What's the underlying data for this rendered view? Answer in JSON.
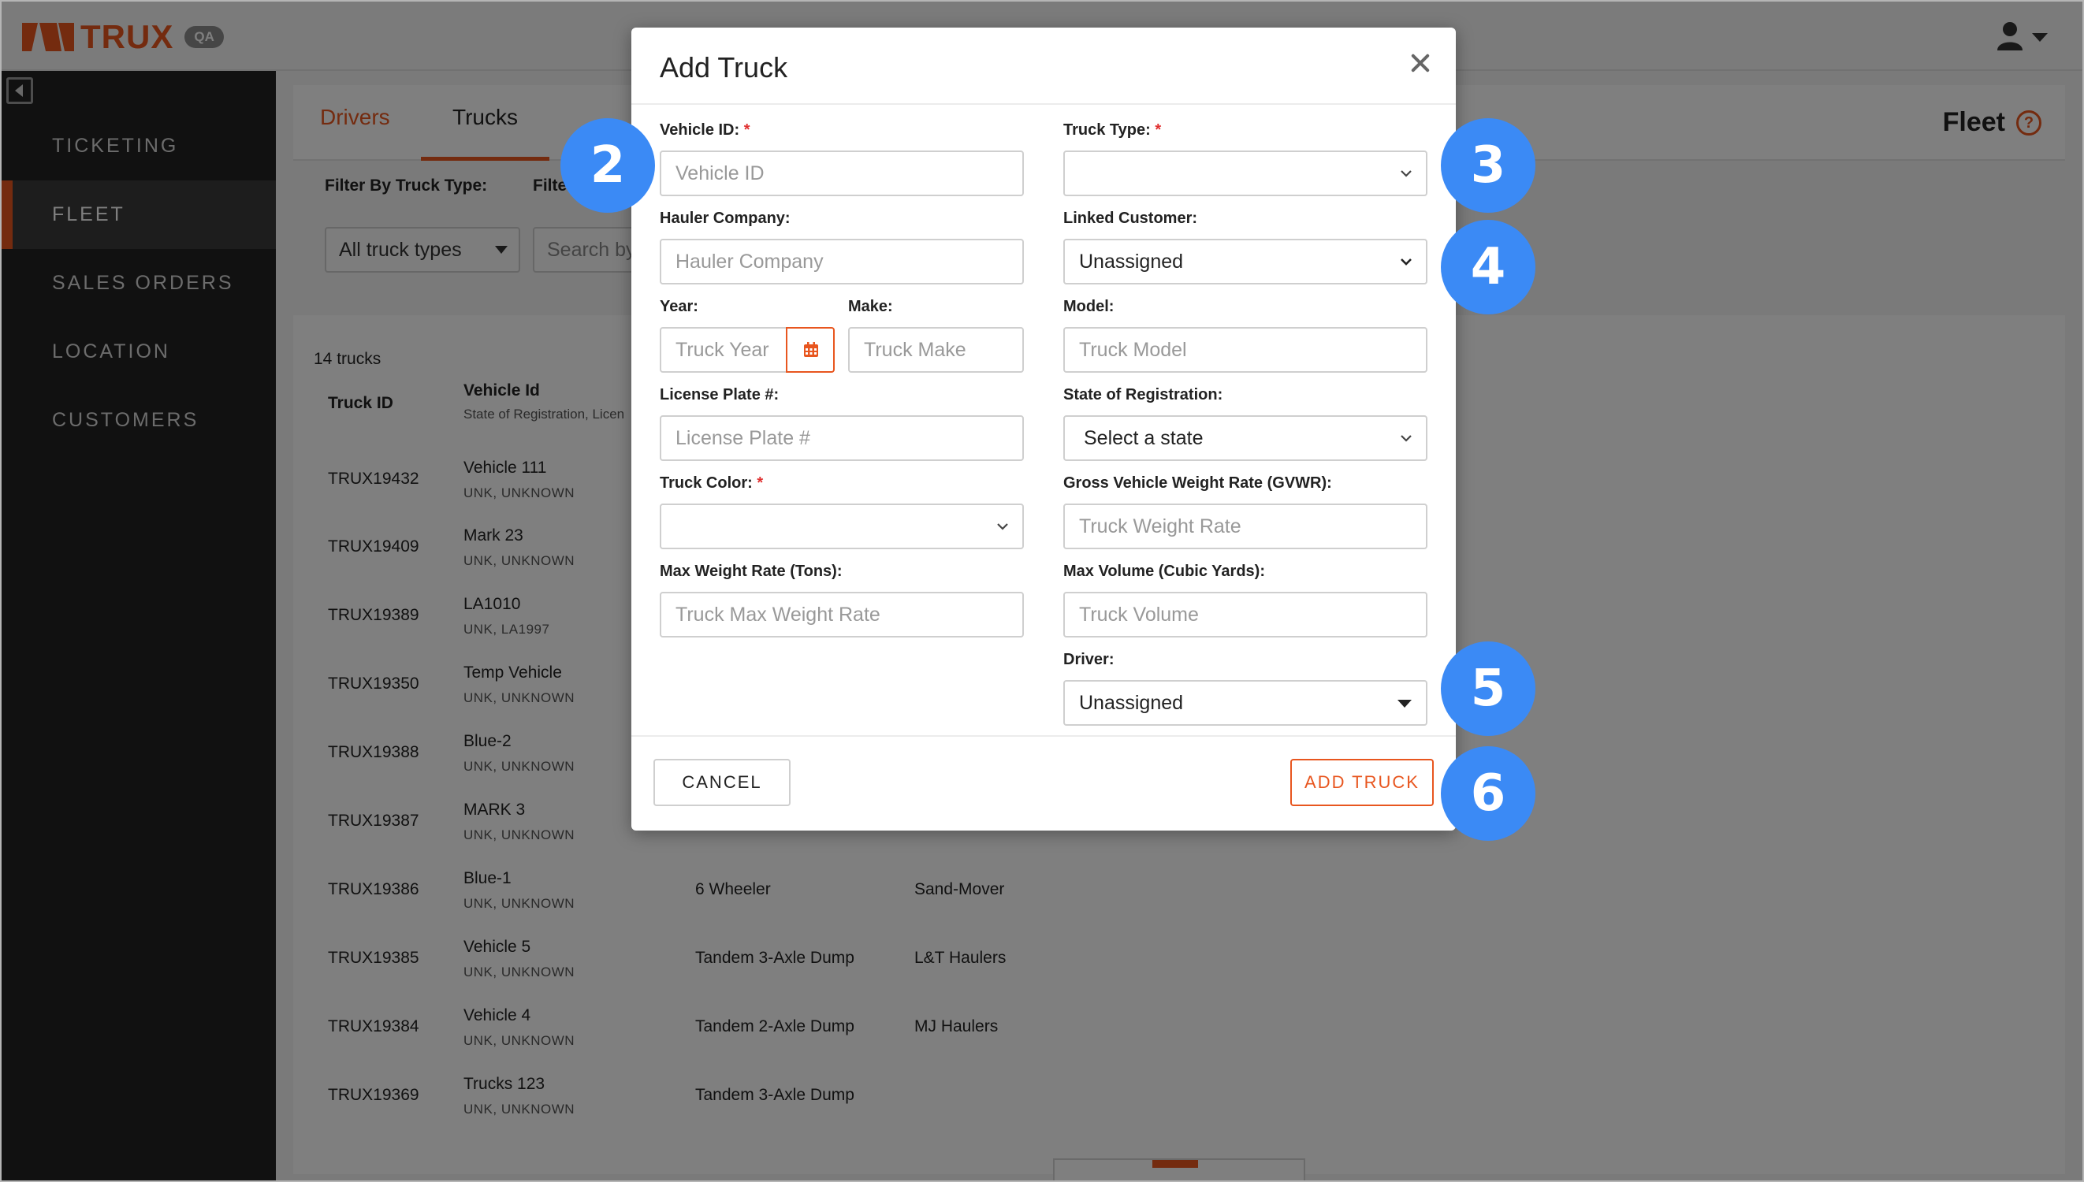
{
  "app": {
    "brand": "TRUX",
    "env_badge": "QA"
  },
  "sidebar": {
    "items": [
      {
        "label": "TICKETING"
      },
      {
        "label": "FLEET"
      },
      {
        "label": "SALES ORDERS"
      },
      {
        "label": "LOCATION"
      },
      {
        "label": "CUSTOMERS"
      }
    ]
  },
  "page": {
    "tabs": [
      "Drivers",
      "Trucks"
    ],
    "title": "Fleet",
    "help_glyph": "?"
  },
  "filters": {
    "truck_type_label": "Filter By Truck Type:",
    "truck_type_value": "All truck types",
    "other_label": "Filter By Truc",
    "search_placeholder": "Search by"
  },
  "table": {
    "count": "14 trucks",
    "headers": {
      "truck_id": "Truck ID",
      "vehicle_id": "Vehicle Id",
      "vehicle_sub": "State of Registration, Licen"
    },
    "rows": [
      {
        "id": "TRUX19432",
        "vehicle": "Vehicle 111",
        "reg": "UNK, UNKNOWN",
        "type": "",
        "hauler": ""
      },
      {
        "id": "TRUX19409",
        "vehicle": "Mark 23",
        "reg": "UNK, UNKNOWN",
        "type": "",
        "hauler": ""
      },
      {
        "id": "TRUX19389",
        "vehicle": "LA1010",
        "reg": "UNK, LA1997",
        "type": "",
        "hauler": ""
      },
      {
        "id": "TRUX19350",
        "vehicle": "Temp Vehicle",
        "reg": "UNK, UNKNOWN",
        "type": "",
        "hauler": ""
      },
      {
        "id": "TRUX19388",
        "vehicle": "Blue-2",
        "reg": "UNK, UNKNOWN",
        "type": "",
        "hauler": ""
      },
      {
        "id": "TRUX19387",
        "vehicle": "MARK 3",
        "reg": "UNK, UNKNOWN",
        "type": "",
        "hauler": ""
      },
      {
        "id": "TRUX19386",
        "vehicle": "Blue-1",
        "reg": "UNK, UNKNOWN",
        "type": "6 Wheeler",
        "hauler": "Sand-Mover"
      },
      {
        "id": "TRUX19385",
        "vehicle": "Vehicle 5",
        "reg": "UNK, UNKNOWN",
        "type": "Tandem 3-Axle Dump",
        "hauler": "L&T Haulers"
      },
      {
        "id": "TRUX19384",
        "vehicle": "Vehicle 4",
        "reg": "UNK, UNKNOWN",
        "type": "Tandem 2-Axle Dump",
        "hauler": "MJ Haulers"
      },
      {
        "id": "TRUX19369",
        "vehicle": "Trucks 123",
        "reg": "UNK, UNKNOWN",
        "type": "Tandem 3-Axle Dump",
        "hauler": ""
      }
    ]
  },
  "modal": {
    "title": "Add Truck",
    "required_mark": "*",
    "fields": {
      "vehicle_id": {
        "label": "Vehicle ID:",
        "placeholder": "Vehicle ID"
      },
      "truck_type": {
        "label": "Truck Type:",
        "value": ""
      },
      "hauler_company": {
        "label": "Hauler Company:",
        "placeholder": "Hauler Company"
      },
      "linked_customer": {
        "label": "Linked Customer:",
        "value": "Unassigned"
      },
      "year": {
        "label": "Year:",
        "placeholder": "Truck Year"
      },
      "make": {
        "label": "Make:",
        "placeholder": "Truck Make"
      },
      "model": {
        "label": "Model:",
        "placeholder": "Truck Model"
      },
      "license_plate": {
        "label": "License Plate #:",
        "placeholder": "License Plate #"
      },
      "state_of_registration": {
        "label": "State of Registration:",
        "value": "Select a state"
      },
      "truck_color": {
        "label": "Truck Color:",
        "value": ""
      },
      "gvwr": {
        "label": "Gross Vehicle Weight Rate (GVWR):",
        "placeholder": "Truck Weight Rate"
      },
      "max_weight": {
        "label": "Max Weight Rate (Tons):",
        "placeholder": "Truck Max Weight Rate"
      },
      "max_volume": {
        "label": "Max Volume (Cubic Yards):",
        "placeholder": "Truck Volume"
      },
      "driver": {
        "label": "Driver:",
        "value": "Unassigned"
      }
    },
    "cancel_label": "CANCEL",
    "add_label": "ADD TRUCK"
  },
  "markers": [
    "2",
    "3",
    "4",
    "5",
    "6"
  ],
  "colors": {
    "accent": "#e8561f",
    "marker": "#3b8af5",
    "sidebar": "#232323",
    "required": "#e03030"
  }
}
